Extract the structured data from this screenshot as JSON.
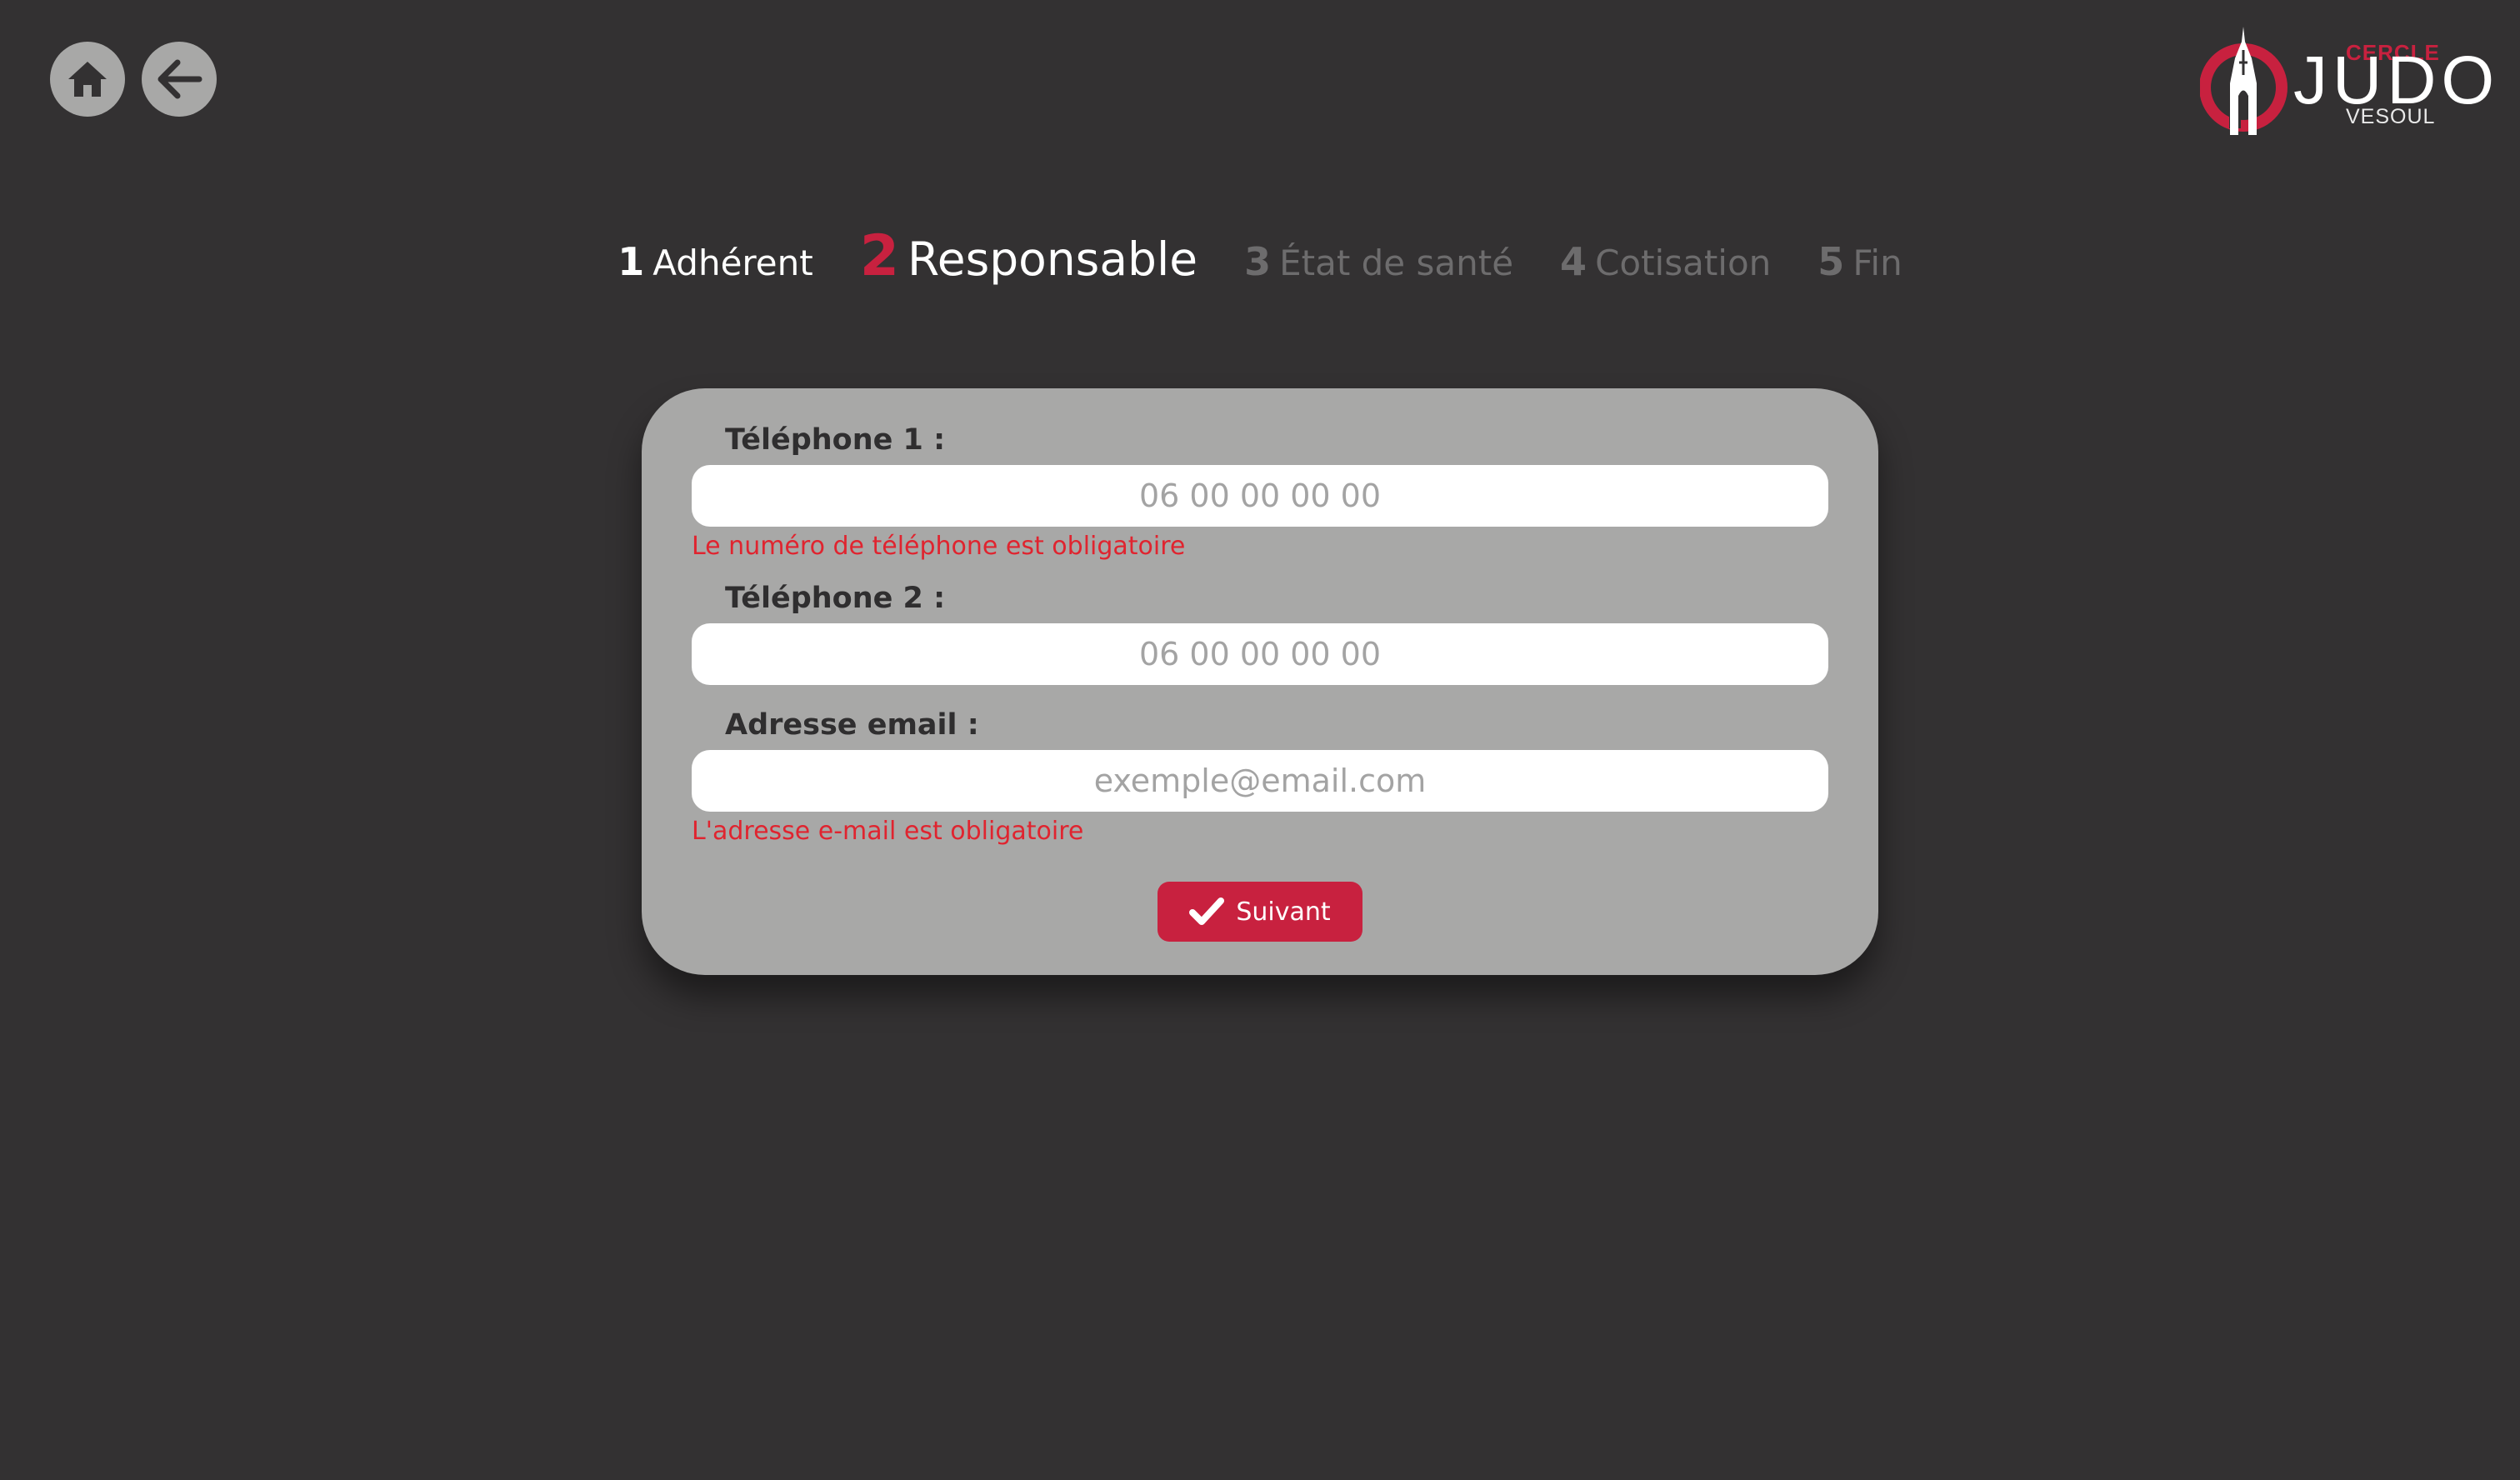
{
  "nav": {
    "home_icon": "home-icon",
    "back_icon": "arrow-left-icon"
  },
  "logo": {
    "cercle": "CERCLE",
    "judo": "JUDO",
    "vesoul": "VESOUL"
  },
  "stepper": {
    "steps": [
      {
        "number": "1",
        "label": "Adhérent",
        "state": "done"
      },
      {
        "number": "2",
        "label": "Responsable",
        "state": "active"
      },
      {
        "number": "3",
        "label": "État de santé",
        "state": "upcoming"
      },
      {
        "number": "4",
        "label": "Cotisation",
        "state": "upcoming"
      },
      {
        "number": "5",
        "label": "Fin",
        "state": "upcoming"
      }
    ]
  },
  "form": {
    "phone1": {
      "label": "Téléphone 1 :",
      "value": "",
      "placeholder": "06 00 00 00 00",
      "error": "Le numéro de téléphone est obligatoire"
    },
    "phone2": {
      "label": "Téléphone 2 :",
      "value": "",
      "placeholder": "06 00 00 00 00"
    },
    "email": {
      "label": "Adresse email :",
      "value": "",
      "placeholder": "exemple@email.com",
      "error": "L'adresse e-mail est obligatoire"
    },
    "submit": {
      "label": "Suivant",
      "icon": "check-icon"
    }
  },
  "colors": {
    "background": "#333132",
    "card": "#a8a8a7",
    "accent": "#c8213f",
    "error": "#e0242f",
    "muted": "#6d6c6d"
  }
}
